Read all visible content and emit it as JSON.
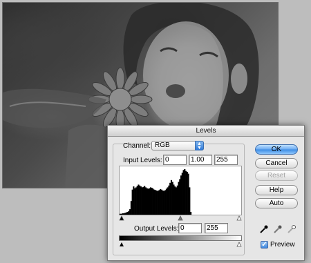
{
  "dialog": {
    "title": "Levels",
    "channel_label": "Channel:",
    "channel_value": "RGB",
    "input_levels_label": "Input Levels:",
    "input_levels": [
      "0",
      "1.00",
      "255"
    ],
    "output_levels_label": "Output Levels:",
    "output_levels": [
      "0",
      "255"
    ],
    "buttons": {
      "ok": "OK",
      "cancel": "Cancel",
      "reset": "Reset",
      "help": "Help",
      "auto": "Auto"
    },
    "preview_label": "Preview",
    "preview_checked": true,
    "eyedroppers": [
      "black-point-eyedropper-icon",
      "gray-point-eyedropper-icon",
      "white-point-eyedropper-icon"
    ]
  },
  "histogram": {
    "bins": [
      2,
      2,
      3,
      3,
      4,
      5,
      6,
      8,
      12,
      30,
      55,
      62,
      58,
      60,
      63,
      66,
      64,
      62,
      60,
      61,
      63,
      60,
      58,
      57,
      58,
      60,
      59,
      57,
      55,
      54,
      53,
      52,
      54,
      56,
      55,
      53,
      52,
      54,
      57,
      60,
      64,
      70,
      76,
      72,
      66,
      62,
      60,
      64,
      72,
      78,
      86,
      92,
      98,
      100,
      96,
      94,
      90,
      60,
      6,
      0,
      0,
      0,
      0,
      0,
      0,
      0,
      0,
      0,
      0,
      0,
      0,
      0,
      0,
      0,
      0,
      0,
      0,
      0,
      0,
      0,
      0,
      0,
      0,
      0,
      0,
      0,
      0,
      0,
      0,
      0,
      0,
      0,
      0,
      0,
      0,
      0,
      0,
      0,
      0,
      0
    ],
    "slider_levels": [
      0,
      0.5,
      1.0
    ]
  },
  "colors": {
    "accent": "#3c8ce4",
    "dialog_bg": "#e6e6e6"
  }
}
